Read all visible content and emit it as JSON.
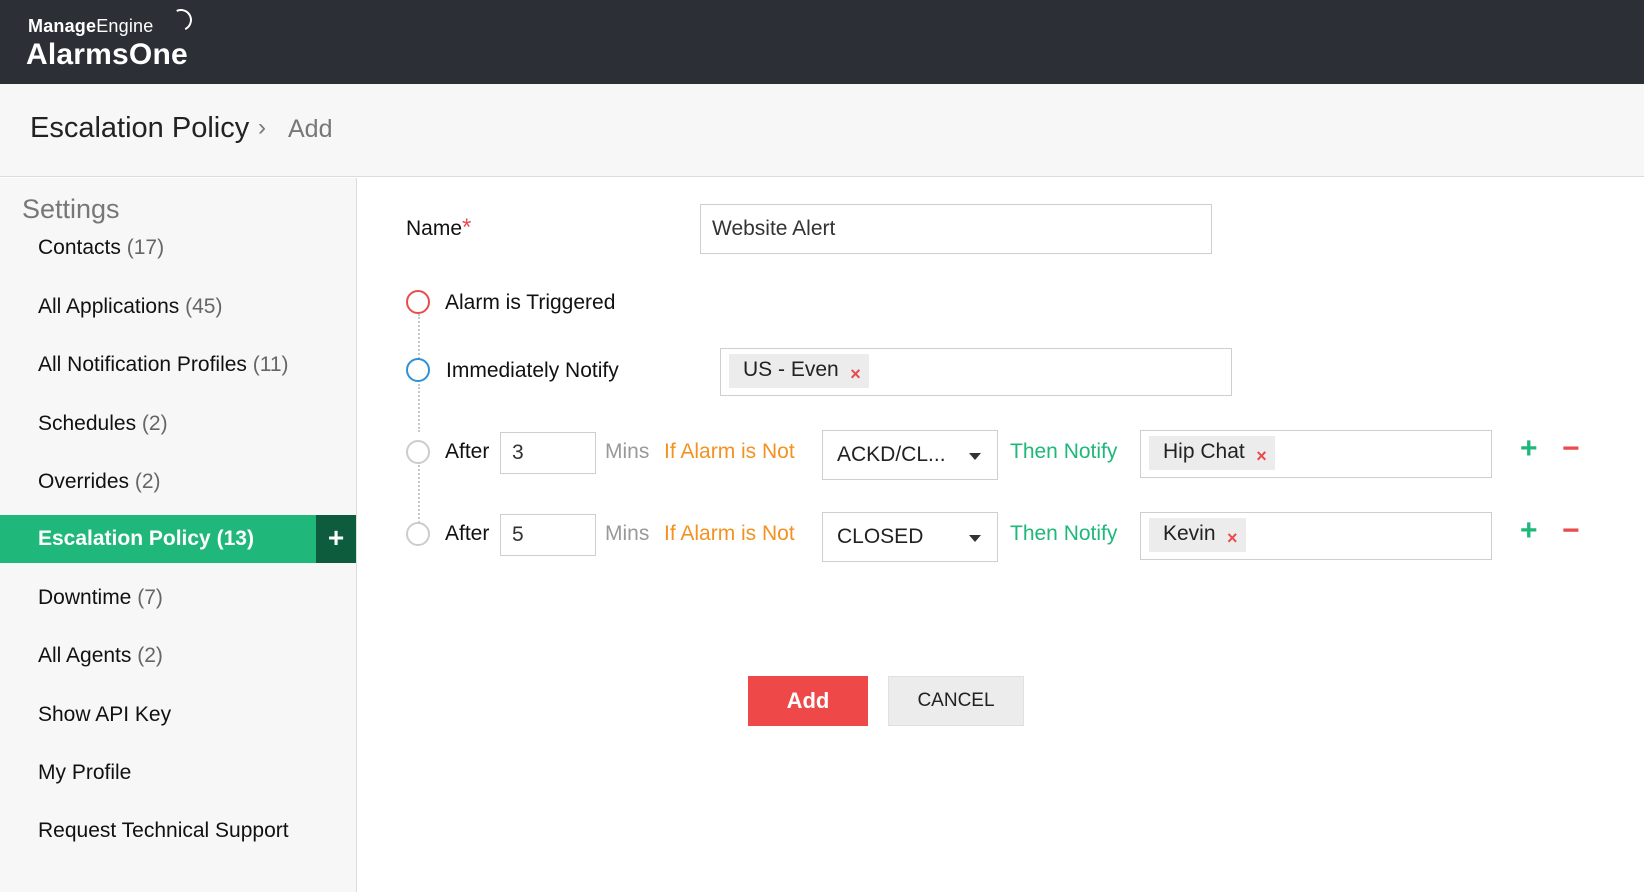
{
  "app": {
    "brand_small_bold": "Manage",
    "brand_small_rest": "Engine",
    "brand_name": "AlarmsOne"
  },
  "breadcrumb": {
    "title": "Escalation Policy",
    "separator": "›",
    "current": "Add"
  },
  "sidebar": {
    "title": "Settings",
    "items": [
      {
        "label": "Contacts",
        "count": "(17)"
      },
      {
        "label": "All Applications",
        "count": "(45)"
      },
      {
        "label": "All Notification Profiles",
        "count": "(11)"
      },
      {
        "label": "Schedules",
        "count": "(2)"
      },
      {
        "label": "Overrides",
        "count": "(2)"
      },
      {
        "label": "Escalation Policy",
        "count": "(13)",
        "active": true
      },
      {
        "label": "Downtime",
        "count": "(7)"
      },
      {
        "label": "All Agents",
        "count": "(2)"
      },
      {
        "label": "Show API Key",
        "count": ""
      },
      {
        "label": "My Profile",
        "count": ""
      },
      {
        "label": "Request Technical Support",
        "count": ""
      }
    ],
    "add_icon": "+"
  },
  "form": {
    "name_label": "Name",
    "required_mark": "*",
    "name_value": "Website Alert",
    "trigger_label": "Alarm is Triggered",
    "immediate_label": "Immediately Notify",
    "immediate_chip": "US - Even",
    "chip_remove": "×",
    "rules": [
      {
        "after_label": "After",
        "minutes": "3",
        "mins_label": "Mins",
        "condition_label": "If Alarm is Not",
        "status": "ACKD/CL...",
        "then_label": "Then Notify",
        "chip": "Hip Chat"
      },
      {
        "after_label": "After",
        "minutes": "5",
        "mins_label": "Mins",
        "condition_label": "If Alarm is Not",
        "status": "CLOSED",
        "then_label": "Then Notify",
        "chip": "Kevin"
      }
    ],
    "add_rule_icon": "+",
    "remove_rule_icon": "−"
  },
  "actions": {
    "add_label": "Add",
    "cancel_label": "CANCEL"
  },
  "colors": {
    "accent_green": "#1fb87a",
    "danger_red": "#ef4848",
    "warning_orange": "#f39220",
    "topbar_dark": "#2c2f35"
  }
}
